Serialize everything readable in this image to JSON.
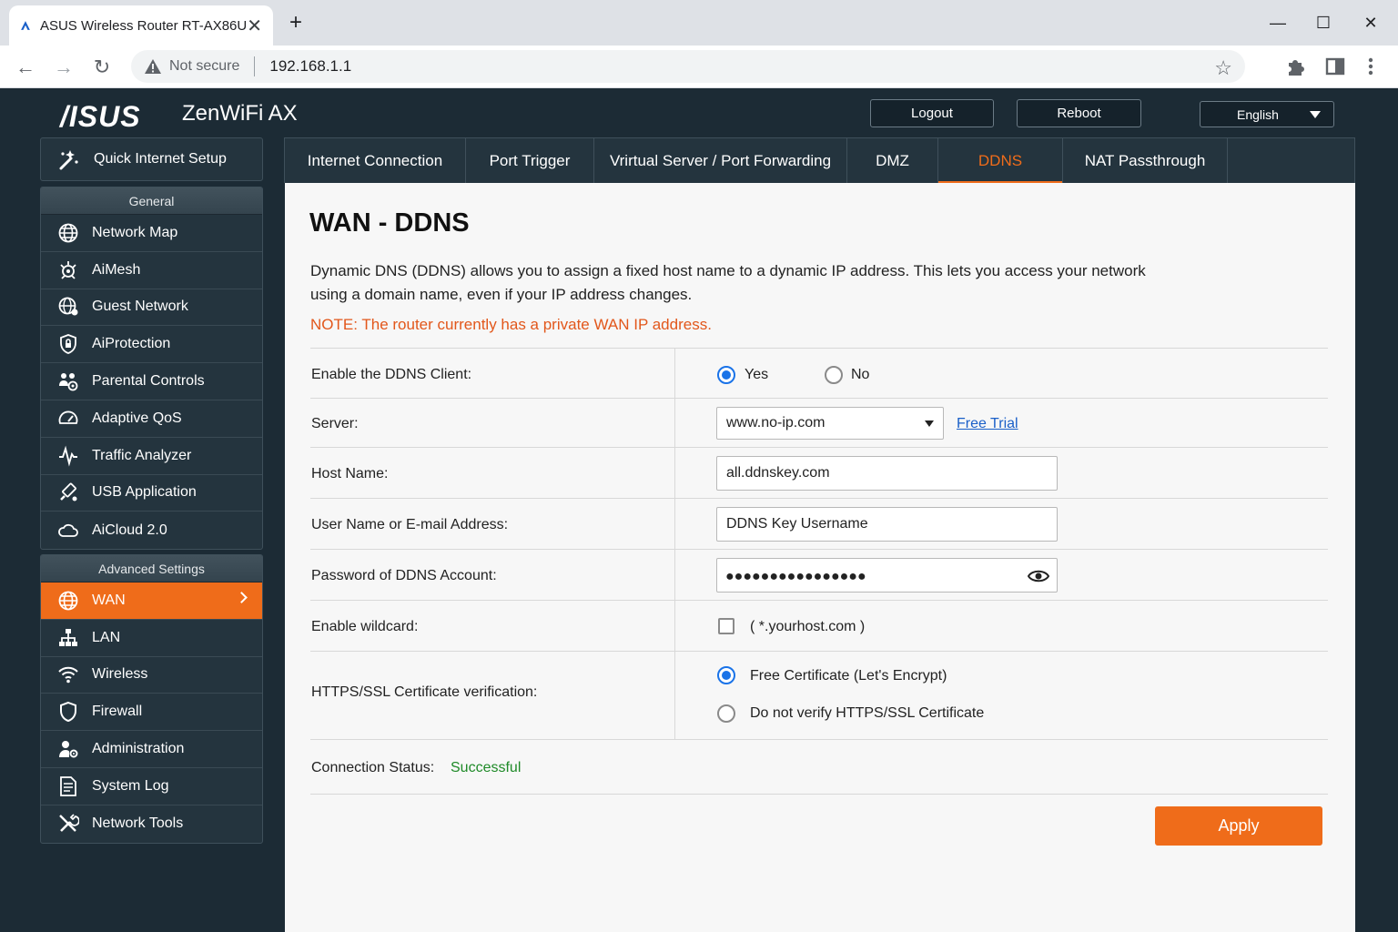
{
  "browser": {
    "tab_title": "ASUS Wireless Router RT-AX86U",
    "tab_close": "✕",
    "new_tab": "+",
    "not_secure": "Not secure",
    "url": "192.168.1.1",
    "window_controls": {
      "minimize": "—",
      "maximize": "☐",
      "close": "✕"
    },
    "nav": {
      "back": "←",
      "forward": "→",
      "reload": "↻"
    },
    "star": "☆"
  },
  "header": {
    "brand": "/ISUS",
    "product": "ZenWiFi AX",
    "logout": "Logout",
    "reboot": "Reboot",
    "language": "English"
  },
  "sidebar": {
    "quick_setup": "Quick Internet Setup",
    "general_title": "General",
    "general_items": [
      {
        "label": "Network Map",
        "icon": "globe-icon"
      },
      {
        "label": "AiMesh",
        "icon": "aimesh-icon"
      },
      {
        "label": "Guest Network",
        "icon": "guest-network-icon"
      },
      {
        "label": "AiProtection",
        "icon": "shield-lock-icon"
      },
      {
        "label": "Parental Controls",
        "icon": "family-icon"
      },
      {
        "label": "Adaptive QoS",
        "icon": "gauge-icon"
      },
      {
        "label": "Traffic Analyzer",
        "icon": "pulse-icon"
      },
      {
        "label": "USB Application",
        "icon": "usb-icon"
      },
      {
        "label": "AiCloud 2.0",
        "icon": "cloud-icon"
      }
    ],
    "advanced_title": "Advanced Settings",
    "advanced_items": [
      {
        "label": "WAN",
        "icon": "globe-icon",
        "active": true
      },
      {
        "label": "LAN",
        "icon": "lan-icon"
      },
      {
        "label": "Wireless",
        "icon": "wifi-icon"
      },
      {
        "label": "Firewall",
        "icon": "shield-icon"
      },
      {
        "label": "Administration",
        "icon": "admin-user-icon"
      },
      {
        "label": "System Log",
        "icon": "log-icon"
      },
      {
        "label": "Network Tools",
        "icon": "tools-icon"
      }
    ]
  },
  "tabs": [
    {
      "label": "Internet Connection"
    },
    {
      "label": "Port Trigger"
    },
    {
      "label": "Vrirtual Server / Port Forwarding"
    },
    {
      "label": "DMZ"
    },
    {
      "label": "DDNS",
      "active": true
    },
    {
      "label": "NAT Passthrough"
    }
  ],
  "main": {
    "title": "WAN - DDNS",
    "description": "Dynamic DNS (DDNS) allows you to assign a fixed host name to a dynamic IP address. This lets you access your network using a domain name, even if your IP address changes.",
    "note": "NOTE: The router currently has a private WAN IP address.",
    "fields": {
      "enable_label": "Enable the DDNS Client:",
      "enable_yes": "Yes",
      "enable_no": "No",
      "enable_value": "Yes",
      "server_label": "Server:",
      "server_value": "www.no-ip.com",
      "free_trial": "Free Trial",
      "host_label": "Host Name:",
      "host_value": "all.ddnskey.com",
      "user_label": "User Name or E-mail Address:",
      "user_value": "DDNS Key Username",
      "password_label": "Password of DDNS Account:",
      "password_mask": "●●●●●●●●●●●●●●●●",
      "wildcard_label": "Enable wildcard:",
      "wildcard_hint": "( *.yourhost.com )",
      "wildcard_checked": false,
      "https_label": "HTTPS/SSL Certificate verification:",
      "https_option1": "Free Certificate (Let's Encrypt)",
      "https_option2": "Do not verify HTTPS/SSL Certificate",
      "https_value": "Free Certificate (Let's Encrypt)"
    },
    "status_label": "Connection Status:",
    "status_value": "Successful",
    "apply": "Apply"
  },
  "colors": {
    "accent": "#ef6c1a",
    "background": "#1c2b35",
    "panel": "#f7f7f7",
    "success": "#1f8a28",
    "link": "#1a5fc8",
    "note": "#e2571b"
  }
}
